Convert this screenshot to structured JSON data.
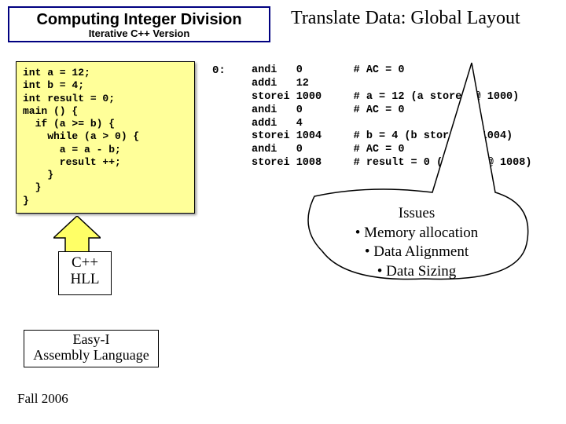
{
  "titleBox": {
    "main": "Computing Integer Division",
    "sub": "Iterative C++ Version"
  },
  "slideTitle": "Translate Data: Global Layout",
  "code": "int a = 12;\nint b = 4;\nint result = 0;\nmain () {\n  if (a >= b) {\n    while (a > 0) {\n      a = a - b;\n      result ++;\n    }\n  }\n}",
  "asmLabel": "0:",
  "asm": "andi   0        # AC = 0\naddi   12\nstorei 1000     # a = 12 (a stored @ 1000)\nandi   0        # AC = 0\naddi   4\nstorei 1004     # b = 4 (b stored @ 1004)\nandi   0        # AC = 0\nstorei 1008     # result = 0 (result @ 1008)",
  "callout": {
    "head": "Issues",
    "b1": "• Memory allocation",
    "b2": "• Data Alignment",
    "b3": "• Data Sizing"
  },
  "cppBox": {
    "l1": "C++",
    "l2": "HLL"
  },
  "easyBox": {
    "l1": "Easy-I",
    "l2": "Assembly Language"
  },
  "footer": "Fall 2006"
}
